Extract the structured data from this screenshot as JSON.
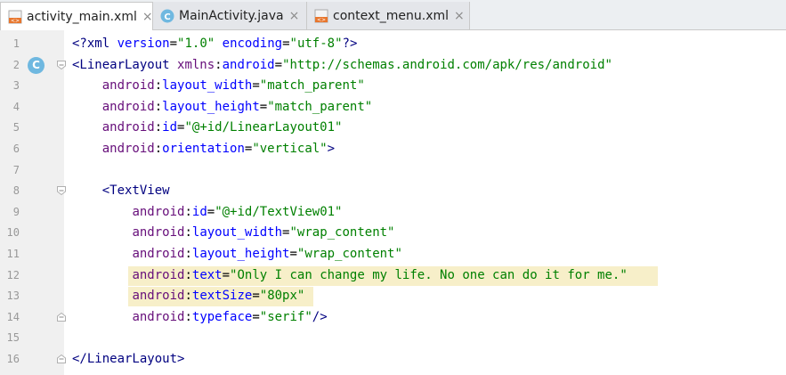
{
  "tabs": [
    {
      "label": "activity_main.xml",
      "icon": "xml-file-icon",
      "active": true
    },
    {
      "label": "MainActivity.java",
      "icon": "java-class-icon",
      "active": false
    },
    {
      "label": "context_menu.xml",
      "icon": "xml-file-icon",
      "active": false
    }
  ],
  "close_glyph": "×",
  "gutter_badge": "C",
  "lines": [
    {
      "n": "1",
      "code": "<?xml version=\"1.0\" encoding=\"utf-8\"?>"
    },
    {
      "n": "2",
      "code": "<LinearLayout xmlns:android=\"http://schemas.android.com/apk/res/android\""
    },
    {
      "n": "3",
      "code": "    android:layout_width=\"match_parent\""
    },
    {
      "n": "4",
      "code": "    android:layout_height=\"match_parent\""
    },
    {
      "n": "5",
      "code": "    android:id=\"@+id/LinearLayout01\""
    },
    {
      "n": "6",
      "code": "    android:orientation=\"vertical\">"
    },
    {
      "n": "7",
      "code": ""
    },
    {
      "n": "8",
      "code": "    <TextView"
    },
    {
      "n": "9",
      "code": "        android:id=\"@+id/TextView01\""
    },
    {
      "n": "10",
      "code": "        android:layout_width=\"wrap_content\""
    },
    {
      "n": "11",
      "code": "        android:layout_height=\"wrap_content\""
    },
    {
      "n": "12",
      "code": "        android:text=\"Only I can change my life. No one can do it for me.\""
    },
    {
      "n": "13",
      "code": "        android:textSize=\"80px\""
    },
    {
      "n": "14",
      "code": "        android:typeface=\"serif\"/>"
    },
    {
      "n": "15",
      "code": ""
    },
    {
      "n": "16",
      "code": "</LinearLayout>"
    }
  ]
}
